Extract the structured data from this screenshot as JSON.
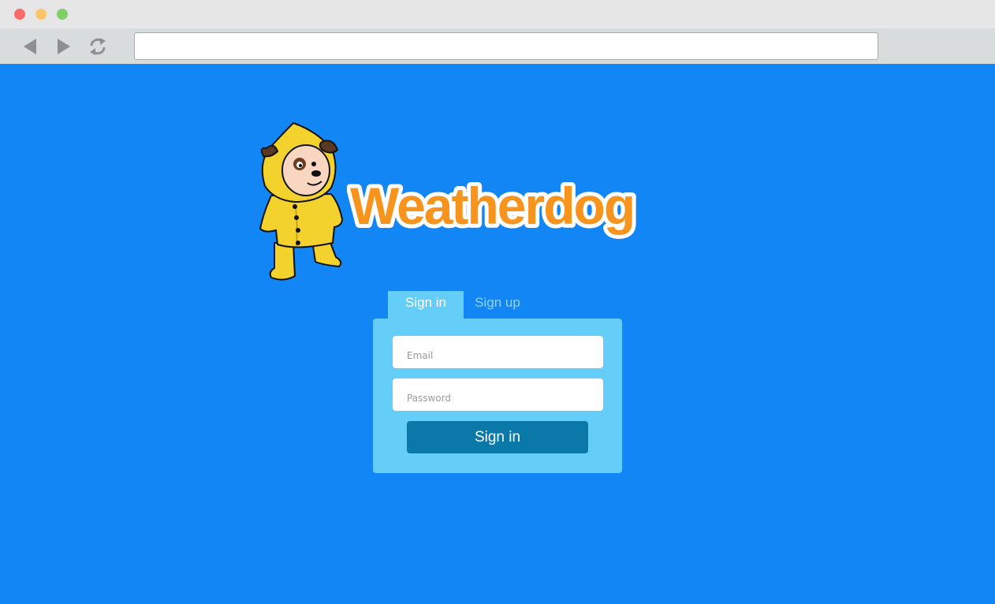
{
  "browser": {
    "url": "",
    "back_icon": "back-arrow-icon",
    "forward_icon": "forward-arrow-icon",
    "reload_icon": "reload-icon"
  },
  "brand": {
    "name": "Weatherdog",
    "text_color": "#f7941d",
    "mascot": "dog-in-yellow-raincoat"
  },
  "auth": {
    "tabs": [
      {
        "label": "Sign in",
        "active": true
      },
      {
        "label": "Sign up",
        "active": false
      }
    ],
    "email_placeholder": "Email",
    "password_placeholder": "Password",
    "submit_label": "Sign in"
  },
  "colors": {
    "page_background": "#1186f4",
    "card_background": "#64cdf8",
    "button_background": "#0a78a8"
  }
}
